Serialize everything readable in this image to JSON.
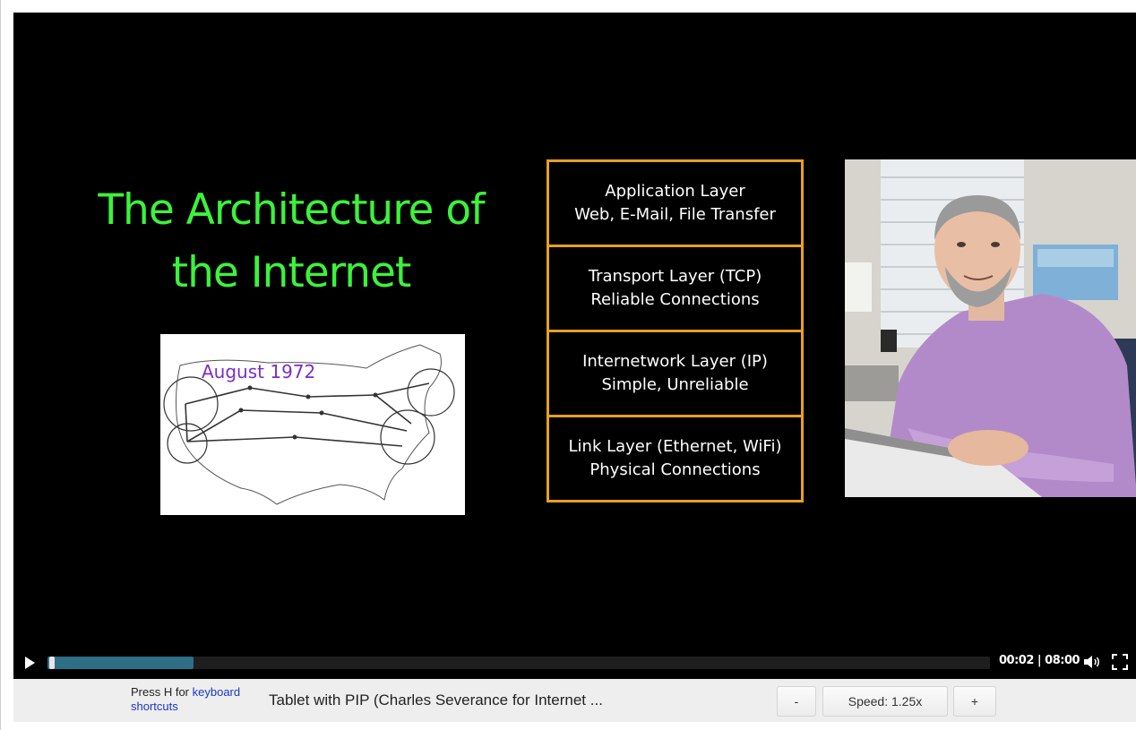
{
  "slide": {
    "title_line1": "The Architecture of",
    "title_line2": "the Internet",
    "map_caption": "August 1972",
    "layers": [
      {
        "name": "Application Layer",
        "detail": "Web, E-Mail, File Transfer"
      },
      {
        "name": "Transport Layer (TCP)",
        "detail": "Reliable Connections"
      },
      {
        "name": "Internetwork Layer (IP)",
        "detail": "Simple, Unreliable"
      },
      {
        "name": "Link Layer (Ethernet, WiFi)",
        "detail": "Physical Connections"
      }
    ]
  },
  "player": {
    "progress_fraction": 0.155,
    "time_display": "00:02 | 08:00"
  },
  "bottom_bar": {
    "help_prefix": "Press H for ",
    "help_link": "keyboard shortcuts",
    "video_name": "Tablet with PIP (Charles Severance for Internet ...",
    "speed_down_label": "-",
    "speed_label": "Speed: 1.25x",
    "speed_up_label": "+"
  },
  "icons": {
    "play": "play-icon",
    "volume": "volume-icon",
    "fullscreen": "fullscreen-icon"
  },
  "colors": {
    "title_green": "#3cf23c",
    "layer_border": "#e8a020",
    "progress_fill": "#2e6f86",
    "link_blue": "#1a35c8"
  }
}
